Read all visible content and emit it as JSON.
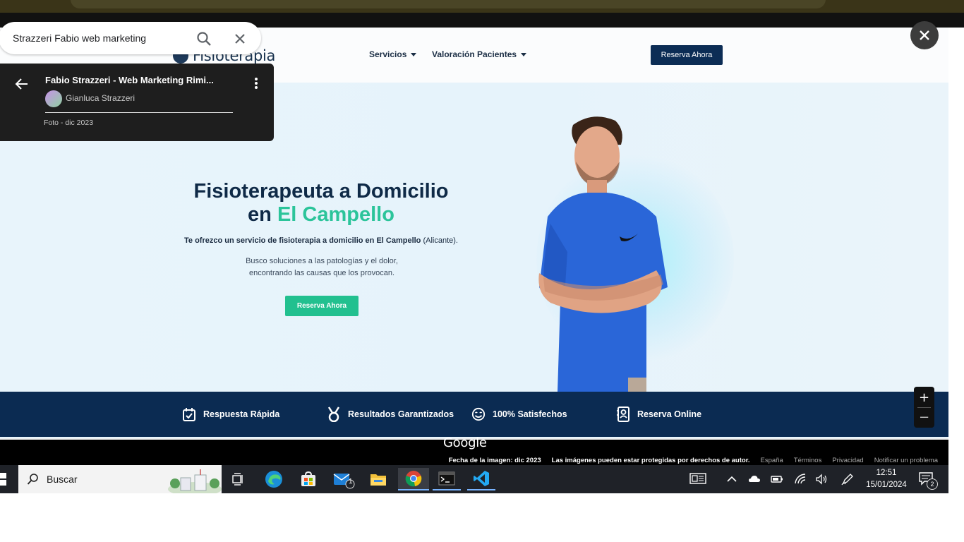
{
  "search": {
    "query": "Strazzeri Fabio web marketing"
  },
  "card": {
    "title": "Fabio Strazzeri - Web Marketing Rimi...",
    "author": "Gianluca Strazzeri",
    "date": "Foto - dic 2023"
  },
  "site": {
    "logo_text": "Fisioterapia",
    "nav": {
      "servicios": "Servicios",
      "valoracion": "Valoración Pacientes",
      "reserva": "Reserva Ahora"
    },
    "hero": {
      "title_line1": "Fisioterapeuta a Domicilio",
      "title_line2_prefix": "en ",
      "title_line2_accent": "El Campello",
      "lead_bold": "Te ofrezco un servicio de fisioterapia a domicilio en El Campello",
      "lead_rest": " (Alicante).",
      "sub_line1": "Busco soluciones a las patologías y el dolor,",
      "sub_line2": "encontrando las causas que los provocan.",
      "cta": "Reserva Ahora"
    },
    "features": [
      {
        "label": "Respuesta Rápida",
        "icon": "calendar-check-icon"
      },
      {
        "label": "Resultados Garantizados",
        "icon": "medal-icon"
      },
      {
        "label": "100% Satisfechos",
        "icon": "smile-icon"
      },
      {
        "label": "Reserva Online",
        "icon": "contact-book-icon"
      }
    ]
  },
  "maps": {
    "logo": "Google",
    "image_date": "Fecha de la imagen: dic 2023",
    "copyright": "Las imágenes pueden estar protegidas por derechos de autor.",
    "links": [
      "España",
      "Términos",
      "Privacidad",
      "Notificar un problema"
    ]
  },
  "taskbar": {
    "search_placeholder": "Buscar",
    "time": "12:51",
    "date": "15/01/2024",
    "mail_badge": "1",
    "notif_badge": "2"
  },
  "colors": {
    "brand_navy": "#0b2b52",
    "accent_green": "#22c08f"
  }
}
